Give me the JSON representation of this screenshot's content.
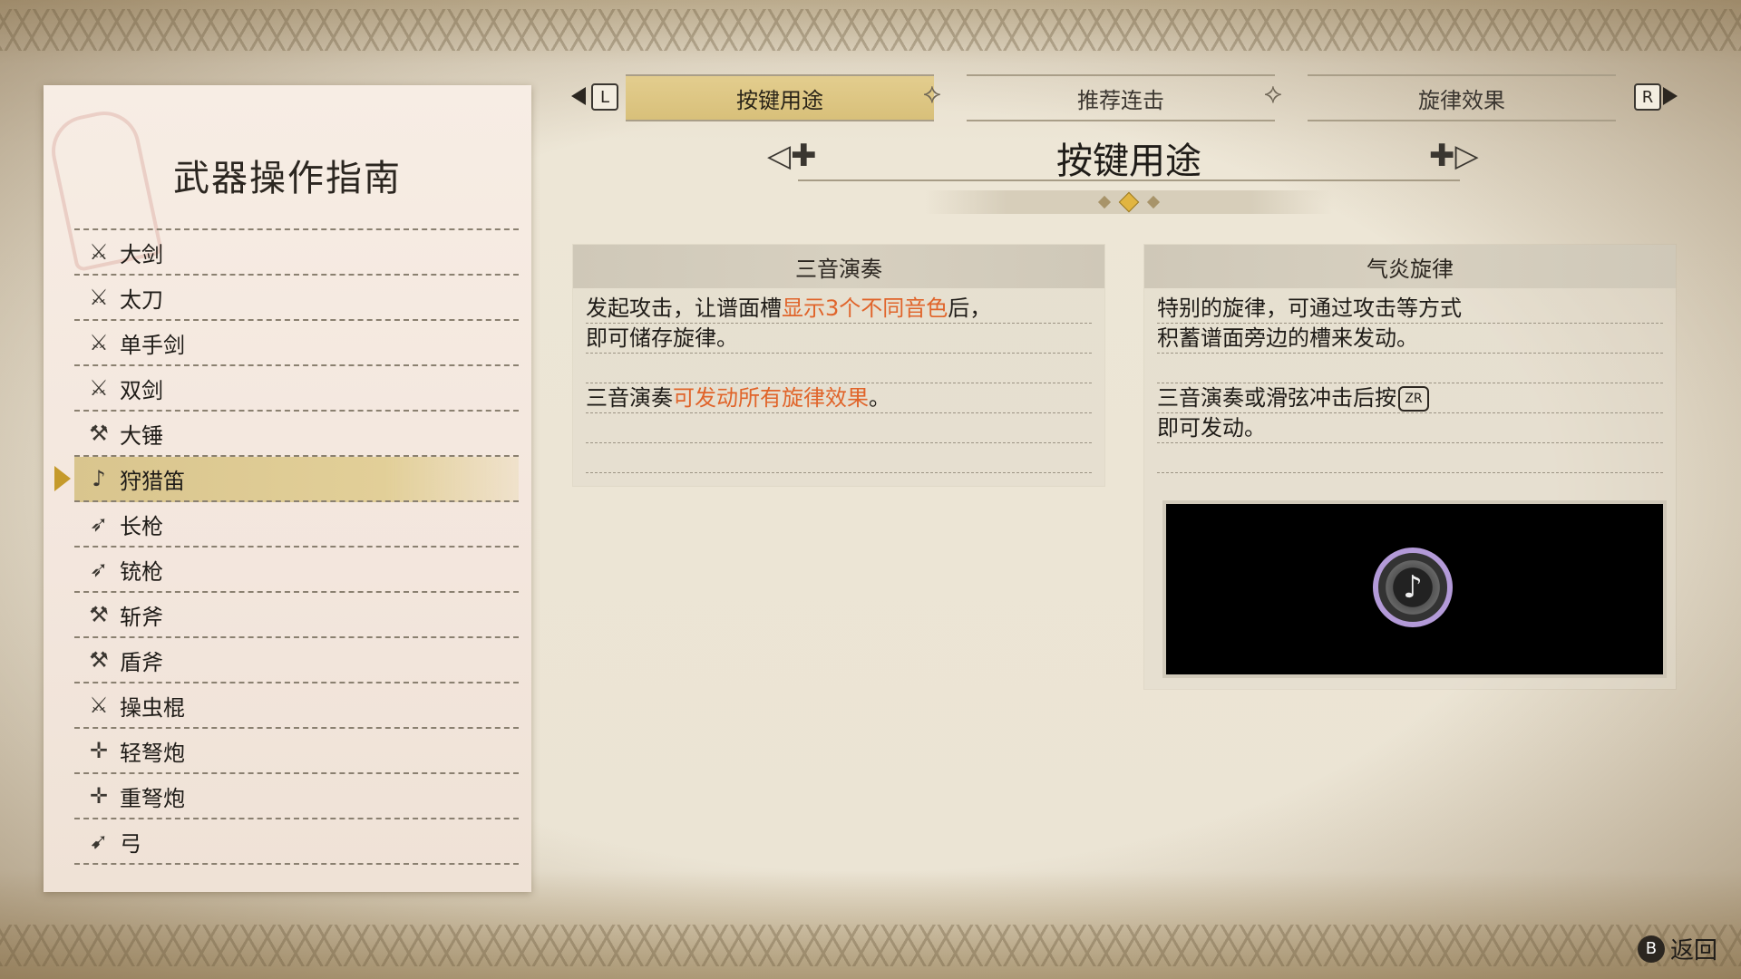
{
  "guide": {
    "title": "武器操作指南",
    "weapons": [
      {
        "label": "大剑",
        "icon": "great-sword-icon",
        "glyph": "⚔"
      },
      {
        "label": "太刀",
        "icon": "long-sword-icon",
        "glyph": "⚔"
      },
      {
        "label": "单手剑",
        "icon": "sword-and-shield-icon",
        "glyph": "⚔"
      },
      {
        "label": "双剑",
        "icon": "dual-blades-icon",
        "glyph": "⚔"
      },
      {
        "label": "大锤",
        "icon": "hammer-icon",
        "glyph": "⚒"
      },
      {
        "label": "狩猎笛",
        "icon": "hunting-horn-icon",
        "glyph": "♪"
      },
      {
        "label": "长枪",
        "icon": "lance-icon",
        "glyph": "➶"
      },
      {
        "label": "铳枪",
        "icon": "gunlance-icon",
        "glyph": "➶"
      },
      {
        "label": "斩斧",
        "icon": "switch-axe-icon",
        "glyph": "⚒"
      },
      {
        "label": "盾斧",
        "icon": "charge-blade-icon",
        "glyph": "⚒"
      },
      {
        "label": "操虫棍",
        "icon": "insect-glaive-icon",
        "glyph": "⚔"
      },
      {
        "label": "轻弩炮",
        "icon": "light-bowgun-icon",
        "glyph": "✛"
      },
      {
        "label": "重弩炮",
        "icon": "heavy-bowgun-icon",
        "glyph": "✛"
      },
      {
        "label": "弓",
        "icon": "bow-icon",
        "glyph": "➹"
      }
    ],
    "selected_index": 5
  },
  "tabs": {
    "left_button": "L",
    "right_button": "R",
    "items": [
      "按键用途",
      "推荐连击",
      "旋律效果"
    ],
    "active_index": 0
  },
  "section": {
    "title": "按键用途",
    "page_count": 3,
    "active_page": 1
  },
  "cards": {
    "left": {
      "heading": "三音演奏",
      "line1_a": "发起攻击，让谱面槽",
      "line1_hl": "显示3个不同音色",
      "line1_b": "后，",
      "line2": "即可储存旋律。",
      "line3": "",
      "line4_a": "三音演奏",
      "line4_hl": "可发动所有旋律效果",
      "line4_b": "。"
    },
    "right": {
      "heading": "气炎旋律",
      "line1": "特别的旋律，可通过攻击等方式",
      "line2": "积蓄谱面旁边的槽来发动。",
      "line3": "",
      "line4_a": "三音演奏或滑弦冲击后按",
      "line4_btn": "ZR",
      "line5": "即可发动。"
    }
  },
  "footer": {
    "button": "B",
    "label": "返回"
  },
  "colors": {
    "highlight": "#e0642a",
    "tab_active": "#e3cd8e",
    "selected_row": "#d9c58e",
    "cursor": "#c59a2b"
  }
}
